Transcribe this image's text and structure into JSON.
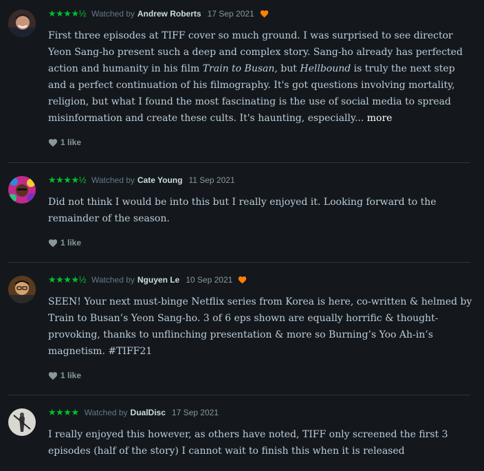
{
  "reviews": [
    {
      "rating": "★★★★½",
      "watched_label": "Watched by",
      "author": "Andrew Roberts",
      "date": "17 Sep 2021",
      "liked": true,
      "text_parts": [
        "First three episodes at TIFF cover so much ground. I was surprised to see director Yeon Sang-ho present such a deep and complex story. Sang-ho already has perfected action and humanity in his film ",
        "Train to Busan",
        ", but ",
        "Hellbound",
        " is truly the next step and a perfect continuation of his filmography. It's got questions involving mortality, religion, but what I found the most fascinating is the use of social media to spread misinformation and create these cults. It's haunting, especially... "
      ],
      "more_label": "more",
      "likes": "1 like"
    },
    {
      "rating": "★★★★½",
      "watched_label": "Watched by",
      "author": "Cate Young",
      "date": "11 Sep 2021",
      "liked": false,
      "text": "Did not think I would be into this but I really enjoyed it. Looking forward to the remainder of the season.",
      "likes": "1 like"
    },
    {
      "rating": "★★★★½",
      "watched_label": "Watched by",
      "author": "Nguyen Le",
      "date": "10 Sep 2021",
      "liked": true,
      "text": "SEEN! Your next must-binge Netflix series from Korea is here, co-written & helmed by Train to Busan’s Yeon Sang-ho. 3 of 6 eps shown are equally horrific & thought-provoking, thanks to unflinching presentation & more so Burning’s Yoo Ah-in’s magnetism. #TIFF21",
      "likes": "1 like"
    },
    {
      "rating": "★★★★",
      "watched_label": "Watched by",
      "author": "DualDisc",
      "date": "17 Sep 2021",
      "liked": false,
      "text": "I really enjoyed this however, as others have noted, TIFF only screened the first 3 episodes (half of the story) I cannot wait to finish this when it is released"
    }
  ],
  "colors": {
    "background": "#14181c",
    "stars": "#00c030",
    "liked_heart": "#ff8000",
    "divider": "#2c3440"
  }
}
